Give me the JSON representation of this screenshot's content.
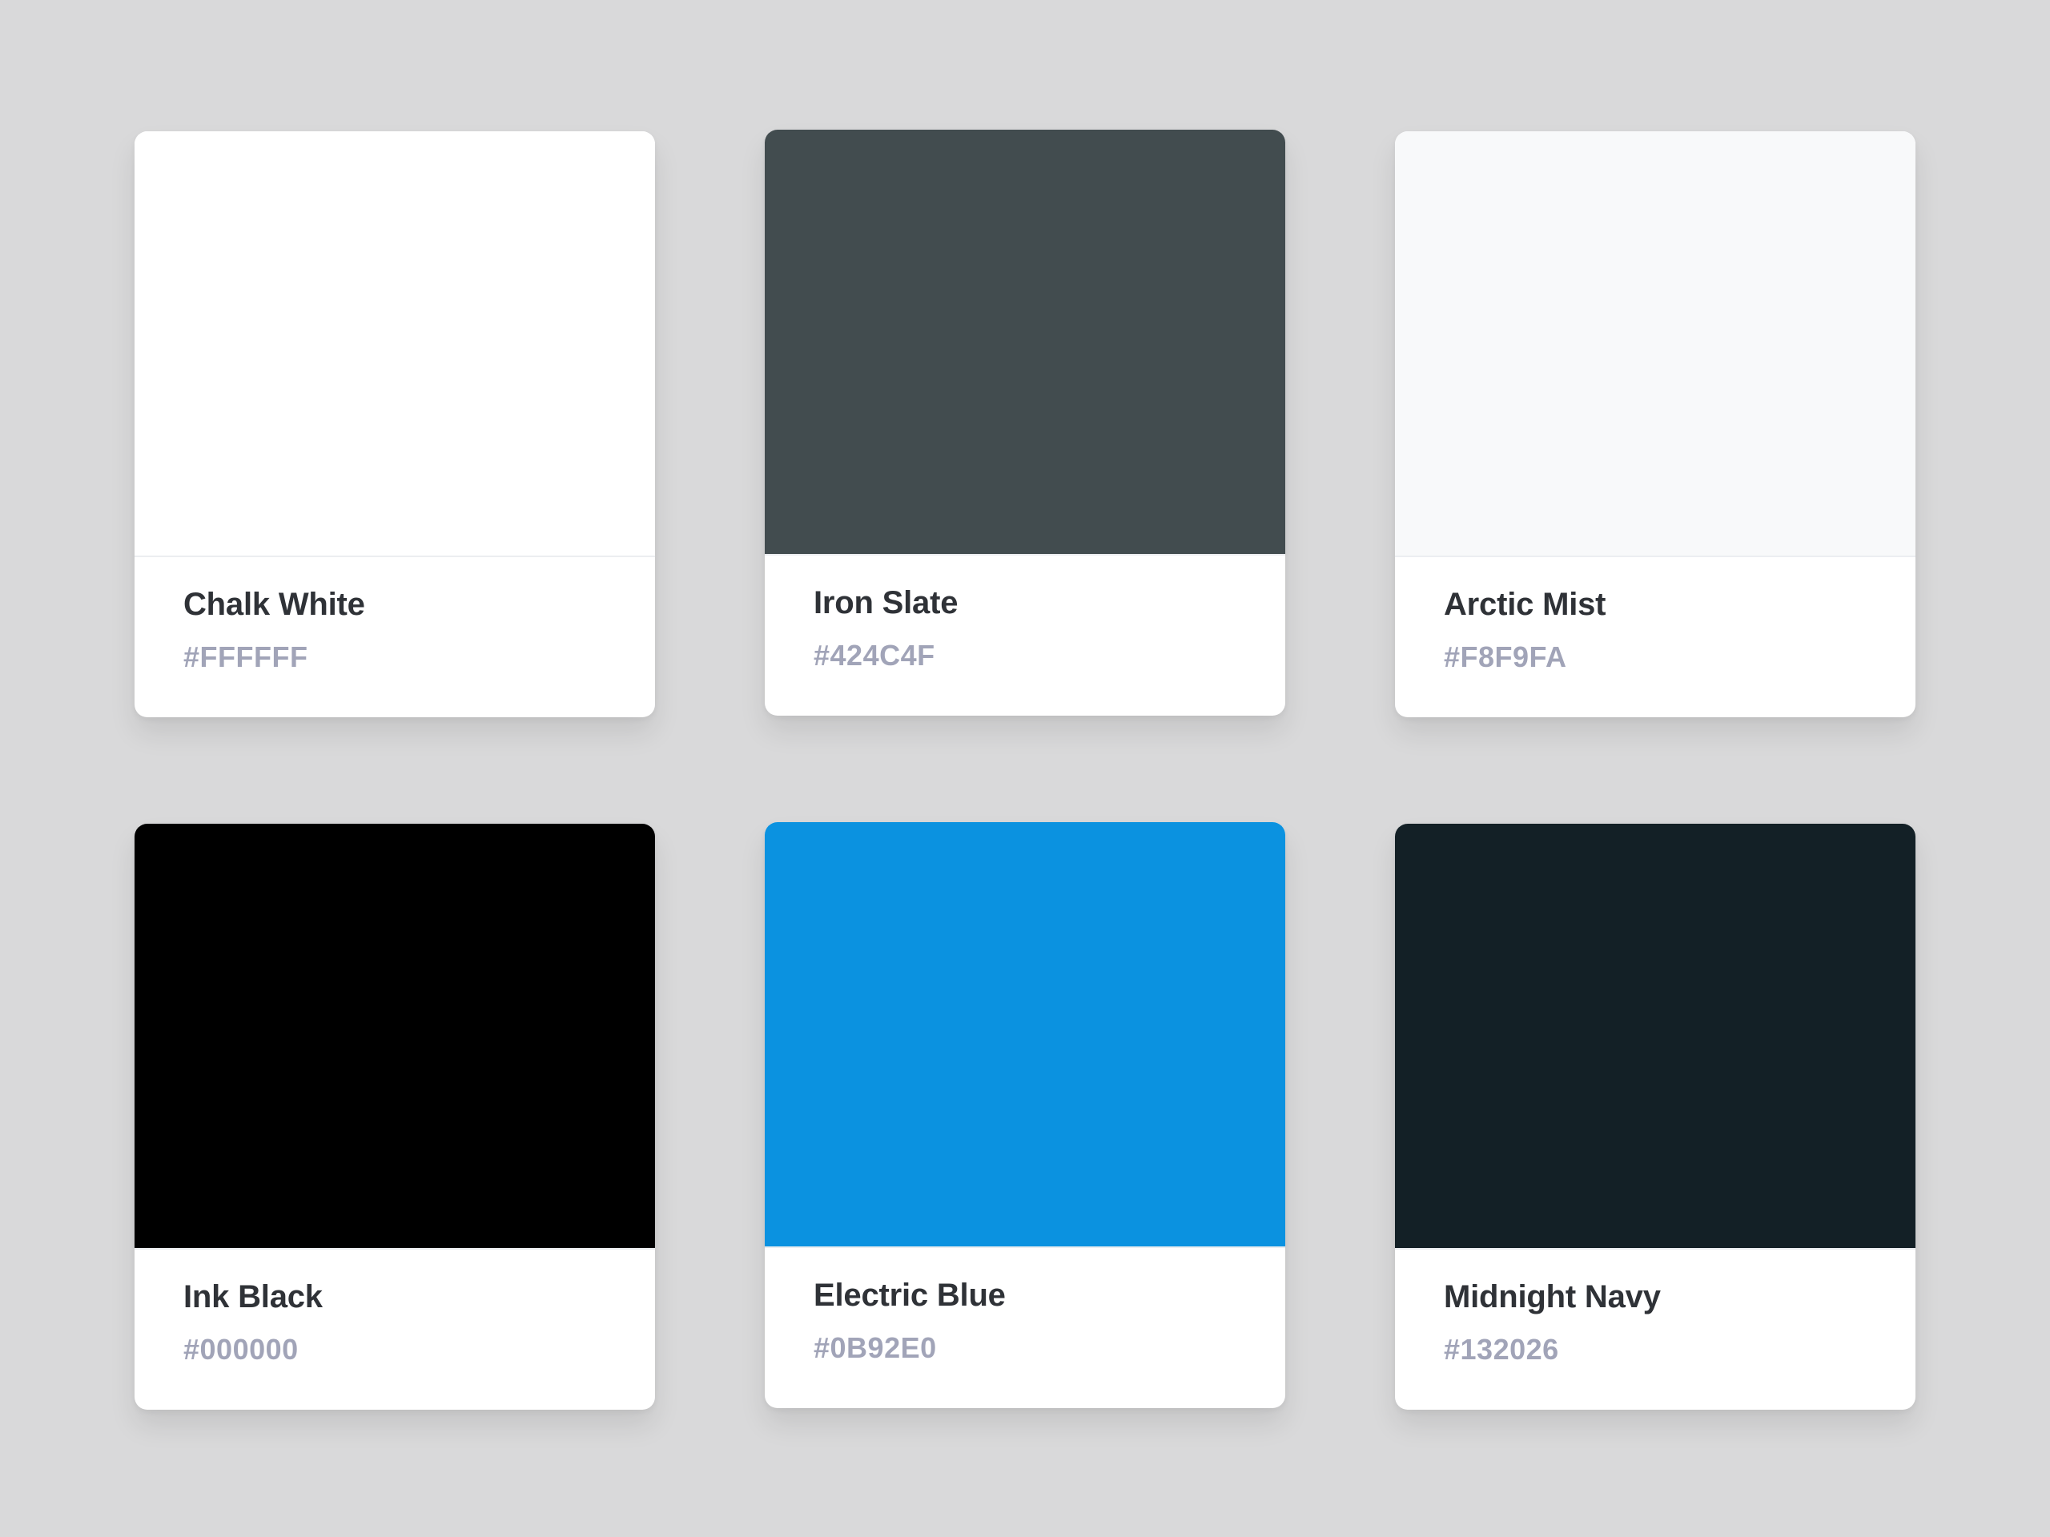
{
  "colors": [
    {
      "name": "Chalk White",
      "hex": "#FFFFFF"
    },
    {
      "name": "Iron Slate",
      "hex": "#424C4F"
    },
    {
      "name": "Arctic Mist",
      "hex": "#F8F9FA"
    },
    {
      "name": "Ink Black",
      "hex": "#000000"
    },
    {
      "name": "Electric Blue",
      "hex": "#0B92E0"
    },
    {
      "name": "Midnight Navy",
      "hex": "#132026"
    }
  ]
}
